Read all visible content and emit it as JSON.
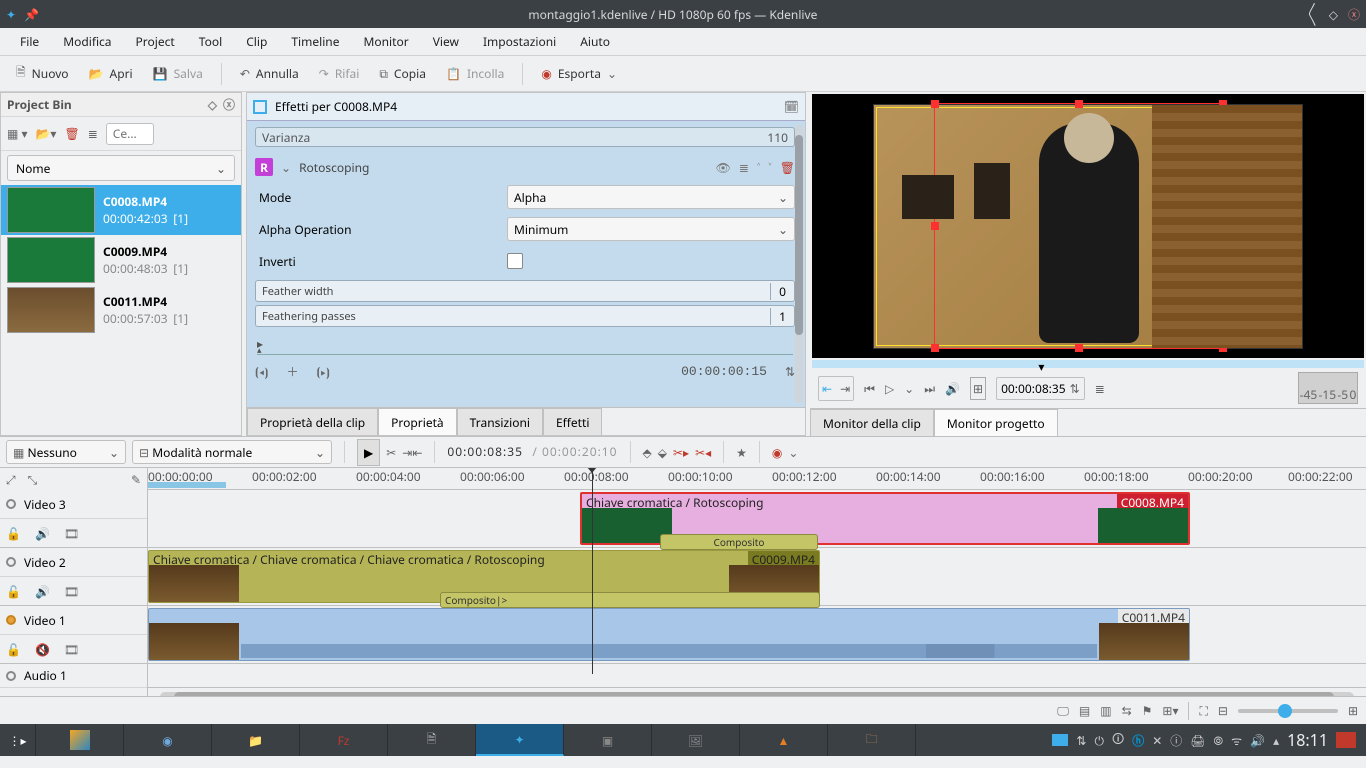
{
  "window": {
    "title": "montaggio1.kdenlive / HD 1080p 60 fps — Kdenlive"
  },
  "menu": [
    "File",
    "Modifica",
    "Project",
    "Tool",
    "Clip",
    "Timeline",
    "Monitor",
    "View",
    "Impostazioni",
    "Aiuto"
  ],
  "toolbar": {
    "new": "Nuovo",
    "open": "Apri",
    "save": "Salva",
    "undo": "Annulla",
    "redo": "Rifai",
    "copy": "Copia",
    "paste": "Incolla",
    "export": "Esporta"
  },
  "bin": {
    "title": "Project Bin",
    "search_placeholder": "Ce...",
    "column": "Nome",
    "clips": [
      {
        "name": "C0008.MP4",
        "dur": "00:00:42:03",
        "take": "[1]"
      },
      {
        "name": "C0009.MP4",
        "dur": "00:00:48:03",
        "take": "[1]"
      },
      {
        "name": "C0011.MP4",
        "dur": "00:00:57:03",
        "take": "[1]"
      }
    ]
  },
  "fx": {
    "header": "Effetti per C0008.MP4",
    "prev_field": {
      "label": "Varianza",
      "value": "110"
    },
    "title": "Rotoscoping",
    "mode_label": "Mode",
    "mode_value": "Alpha",
    "alpha_label": "Alpha Operation",
    "alpha_value": "Minimum",
    "invert_label": "Inverti",
    "feather_label": "Feather width",
    "feather_value": "0",
    "passes_label": "Feathering passes",
    "passes_value": "1",
    "timecode": "00:00:00:15"
  },
  "prop_tabs": [
    "Proprietà della clip",
    "Proprietà",
    "Transizioni",
    "Effetti"
  ],
  "monitor": {
    "timecode": "00:00:08:35",
    "meter": [
      "-45",
      "-15",
      "-5",
      "0"
    ],
    "tabs": [
      "Monitor della clip",
      "Monitor progetto"
    ]
  },
  "tl_tool": {
    "none": "Nessuno",
    "mode": "Modalità normale",
    "tc": "00:00:08:35",
    "dur": "00:00:20:10"
  },
  "ruler": [
    "00:00:00:00",
    "00:00:02:00",
    "00:00:04:00",
    "00:00:06:00",
    "00:00:08:00",
    "00:00:10:00",
    "00:00:12:00",
    "00:00:14:00",
    "00:00:16:00",
    "00:00:18:00",
    "00:00:20:00",
    "00:00:22:00"
  ],
  "tracks": {
    "v3": "Video 3",
    "v2": "Video 2",
    "v1": "Video 1",
    "a1": "Audio 1"
  },
  "clips_tl": {
    "v3_fx": "Chiave cromatica / Rotoscoping",
    "v3_name": "C0008.MP4",
    "v2_fx": "Chiave cromatica / Chiave cromatica / Chiave cromatica / Rotoscoping",
    "v2_name": "C0009.MP4",
    "v1_name": "C0011.MP4",
    "comp1": "Composito",
    "comp2": "Composito|>"
  },
  "taskbar": {
    "time": "18:11"
  }
}
